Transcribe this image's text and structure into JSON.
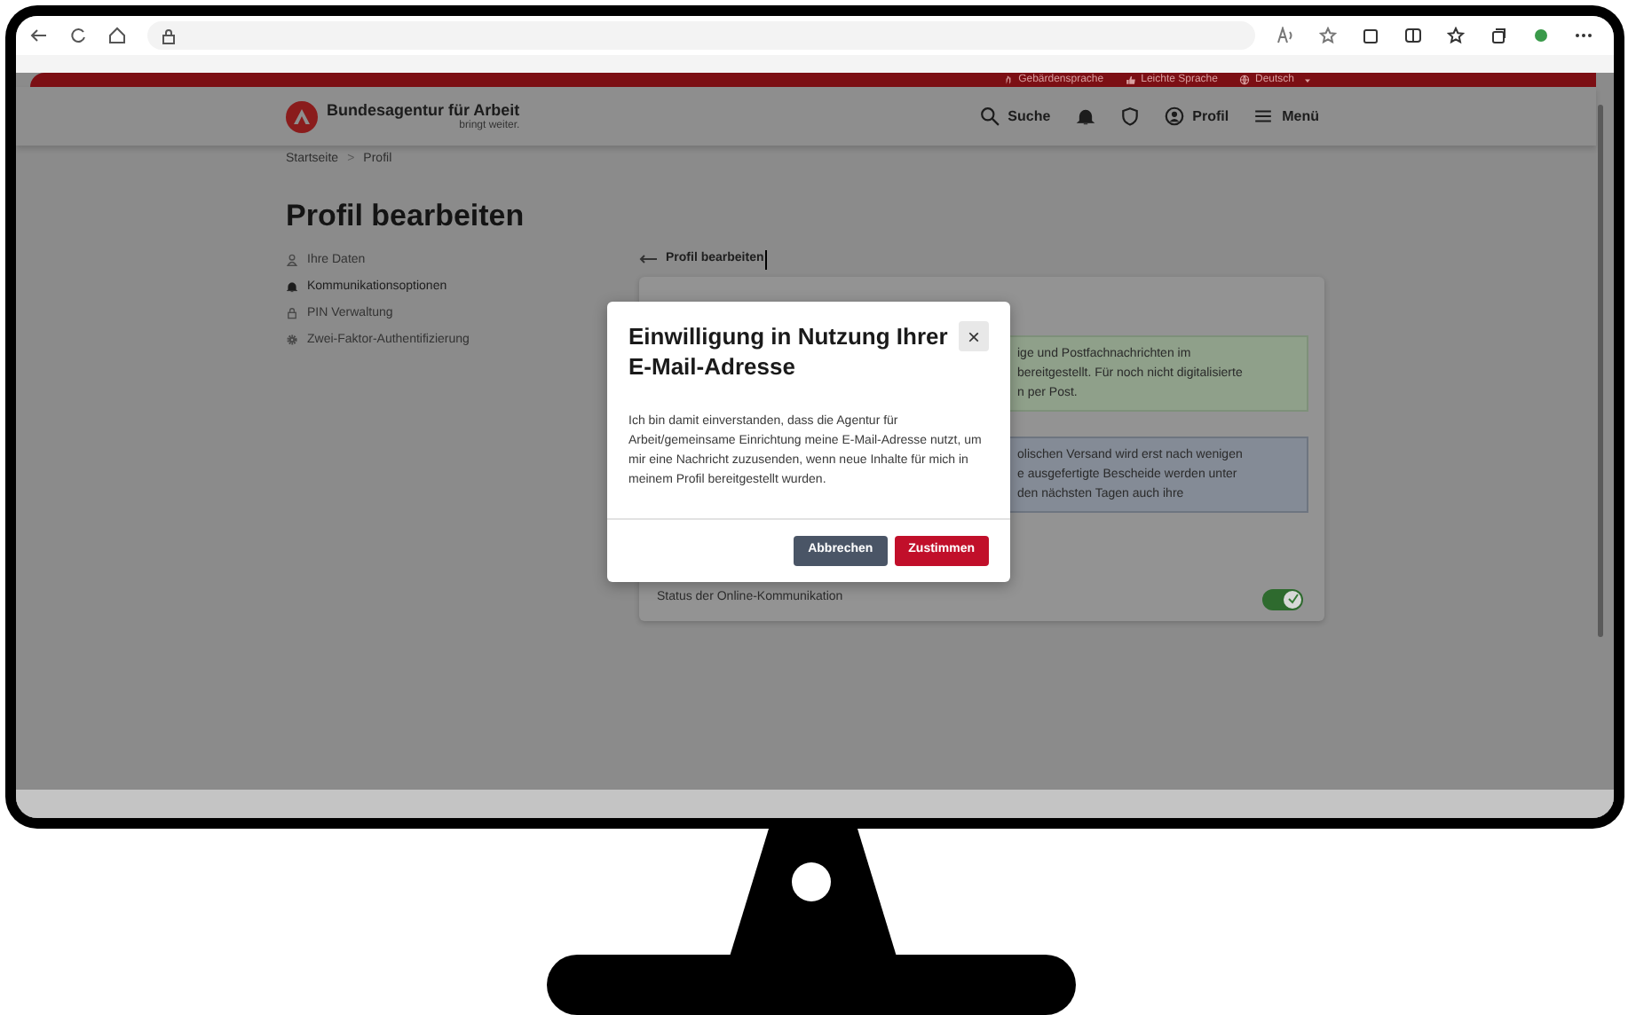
{
  "service_links": [
    {
      "label": "Gebärdensprache",
      "kind": "hand",
      "dropdown": false
    },
    {
      "label": "Leichte Sprache",
      "kind": "easy",
      "dropdown": false
    },
    {
      "label": "Deutsch",
      "kind": "globe",
      "dropdown": true
    }
  ],
  "header": {
    "brand": "Bundesagentur für Arbeit",
    "tagline": "bringt weiter.",
    "nav": [
      {
        "kind": "search",
        "label": "Suche"
      },
      {
        "kind": "bell"
      },
      {
        "kind": "shield"
      },
      {
        "kind": "profile",
        "label": "Profil"
      },
      {
        "kind": "menu",
        "label": "Menü"
      }
    ]
  },
  "breadcrumb": {
    "items": [
      "Startseite",
      "Profil"
    ],
    "separator": ">"
  },
  "page_title": "Profil bearbeiten",
  "sidebar": {
    "items": [
      {
        "kind": "person",
        "label": "Ihre Daten",
        "selected": false
      },
      {
        "kind": "bell",
        "label": "Kommunikationsoptionen",
        "selected": true
      },
      {
        "kind": "lock",
        "label": "PIN Verwaltung",
        "selected": false
      },
      {
        "kind": "gear",
        "label": "Zwei-Faktor-Authentifizierung",
        "selected": false
      }
    ]
  },
  "back_link": "Profil bearbeiten",
  "card": {
    "info_boxes": [
      {
        "kind": "success",
        "lines": [
          "ige und Postfachnachrichten im",
          "bereitgestellt. Für noch nicht digitalisierte",
          "n per Post."
        ]
      },
      {
        "kind": "info",
        "lines": [
          "olischen Versand wird erst nach wenigen",
          "e ausgefertigte Bescheide werden unter",
          "den nächsten Tagen auch ihre"
        ]
      }
    ],
    "status_label": "Status der Online-Kommunikation",
    "toggle": {
      "on": true
    }
  },
  "modal": {
    "title": "Einwilligung in Nutzung Ihrer E-Mail-Adresse",
    "close": "×",
    "body": "Ich bin damit einverstanden, dass die Agentur für Arbeit/gemeinsame Einrichtung meine E-Mail-Adresse nutzt, um mir eine Nachricht zuzusenden, wenn neue Inhalte für mich in meinem Profil bereitgestellt wurden.",
    "buttons": [
      {
        "label": "Abbrechen",
        "kind": "secondary"
      },
      {
        "label": "Zustimmen",
        "kind": "primary"
      }
    ]
  }
}
